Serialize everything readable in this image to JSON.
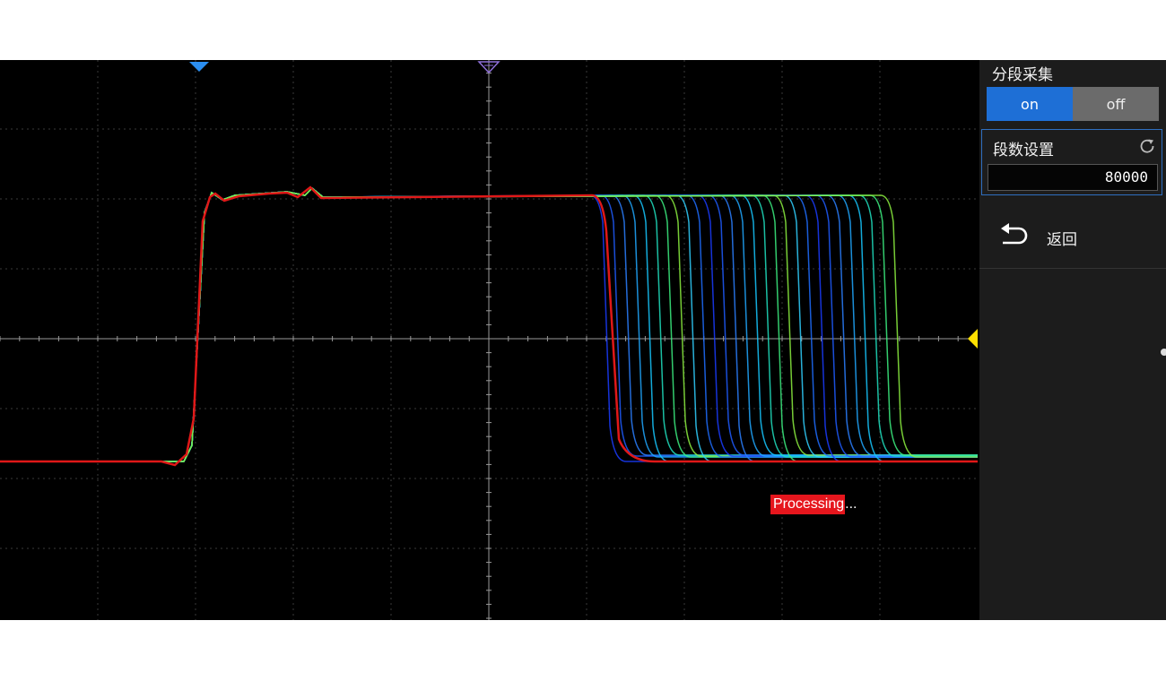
{
  "panel": {
    "title": "分段采集",
    "toggle_on": "on",
    "toggle_off": "off",
    "toggle_state": "on",
    "segments_label": "段数设置",
    "segments_value": "80000",
    "back_label": "返回"
  },
  "status": {
    "processing_highlight": "Processing",
    "processing_rest": "..."
  },
  "markers": {
    "trigger_position_icon": "filled-blue-triangle-down",
    "time_reference_icon": "hollow-purple-triangle-down",
    "trigger_level_icon": "yellow-triangle-left"
  },
  "colors": {
    "accent": "#1e6fd6",
    "trace_red": "#e01818",
    "trigger_level": "#ffe000",
    "processing_bg": "#e6161d"
  },
  "waveform": {
    "description_free": true,
    "overlay_count_visible": 28
  }
}
